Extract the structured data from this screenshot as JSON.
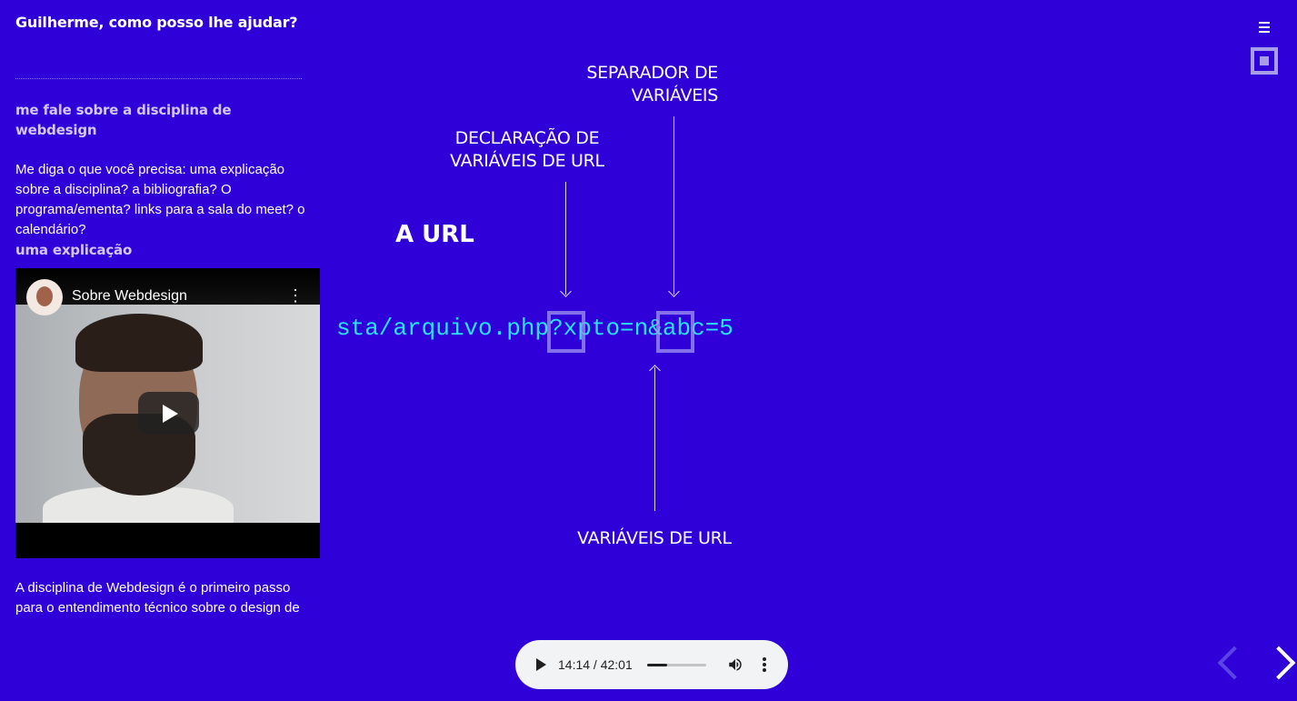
{
  "chat": {
    "greeting": "Guilherme, como posso lhe ajudar?",
    "user_message_1": "me fale sobre a disciplina de webdesign",
    "bot_message_1": "Me diga o que você precisa: uma explicação sobre a disciplina? a bibliografia? O programa/ementa? links para a sala do meet? o calendário?",
    "user_message_2": "uma explicação",
    "video": {
      "title": "Sobre Webdesign"
    },
    "bot_message_2": "A disciplina de Webdesign é o primeiro passo para o entendimento técnico sobre o design de"
  },
  "slide": {
    "title": "A URL",
    "url_text": "sta/arquivo.php?xpto=n&abc=5",
    "label_separator": "SEPARADOR DE VARIÁVEIS",
    "label_declaration": "DECLARAÇÃO DE VARIÁVEIS DE URL",
    "label_variables": "VARIÁVEIS DE URL"
  },
  "audio": {
    "current_time": "14:14",
    "duration": "42:01",
    "time_display": "14:14 / 42:01",
    "progress_fraction": 0.337
  },
  "colors": {
    "background": "#3000d8",
    "url_text": "#29e2f5",
    "accent": "#a89ee8"
  },
  "icons": {
    "menu": "hamburger-icon",
    "fullscreen": "fullscreen-icon",
    "prev": "chevron-left-icon",
    "next": "chevron-right-icon",
    "play": "play-icon",
    "volume": "volume-icon",
    "more": "more-vertical-icon"
  }
}
